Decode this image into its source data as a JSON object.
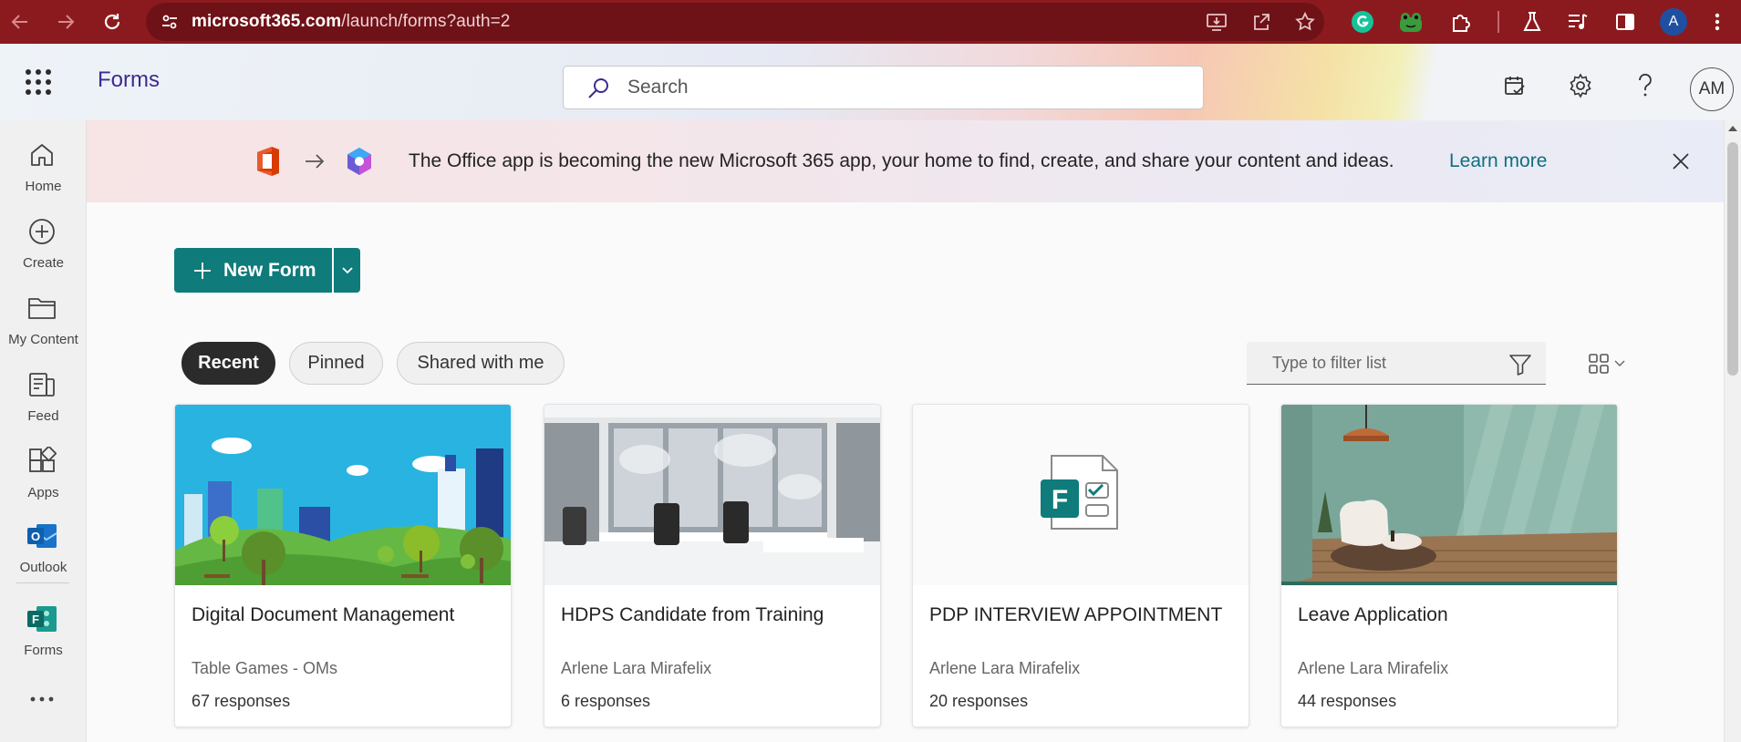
{
  "browser": {
    "url_host": "microsoft365.com",
    "url_path": "/launch/forms?auth=2",
    "profile_initial": "A",
    "icons": [
      "back-icon",
      "forward-icon",
      "reload-icon",
      "site-info-icon",
      "install-app-icon",
      "share-icon",
      "bookmark-star-icon",
      "grammarly-icon",
      "frog-extension-icon",
      "extensions-icon",
      "labs-icon",
      "media-icon",
      "side-panel-icon",
      "menu-icon"
    ]
  },
  "header": {
    "app_name": "Forms",
    "search_placeholder": "Search",
    "avatar_initials": "AM",
    "icons": [
      "waffle-icon",
      "search-icon",
      "todo-icon",
      "settings-icon",
      "help-icon"
    ]
  },
  "rail": {
    "items": [
      {
        "label": "Home",
        "icon": "home-icon"
      },
      {
        "label": "Create",
        "icon": "create-icon"
      },
      {
        "label": "My Content",
        "icon": "folder-icon"
      },
      {
        "label": "Feed",
        "icon": "feed-icon"
      },
      {
        "label": "Apps",
        "icon": "apps-icon"
      },
      {
        "label": "Outlook",
        "icon": "outlook-icon"
      },
      {
        "label": "Forms",
        "icon": "forms-icon"
      }
    ]
  },
  "banner": {
    "text": "The Office app is becoming the new Microsoft 365 app, your home to find, create, and share your content and ideas.",
    "link": "Learn more"
  },
  "main": {
    "new_form_label": "New Form",
    "tabs": [
      {
        "label": "Recent",
        "active": true
      },
      {
        "label": "Pinned",
        "active": false
      },
      {
        "label": "Shared with me",
        "active": false
      }
    ],
    "filter_placeholder": "Type to filter list",
    "cards": [
      {
        "title": "Digital Document Management",
        "owner": "Table Games - OMs",
        "responses": "67 responses",
        "thumb": "city-park-illustration"
      },
      {
        "title": "HDPS Candidate from Training",
        "owner": "Arlene Lara Mirafelix",
        "responses": "6 responses",
        "thumb": "office-room-photo"
      },
      {
        "title": "PDP INTERVIEW APPOINTMENT",
        "owner": "Arlene Lara Mirafelix",
        "responses": "20 responses",
        "thumb": "forms-logo"
      },
      {
        "title": "Leave Application",
        "owner": "Arlene Lara Mirafelix",
        "responses": "44 responses",
        "thumb": "living-room-photo"
      }
    ]
  },
  "colors": {
    "browser_bar": "#8b1a1f",
    "accent_teal": "#0f7b7b",
    "app_name": "#3d2a8f",
    "link": "#0f6f7f"
  }
}
